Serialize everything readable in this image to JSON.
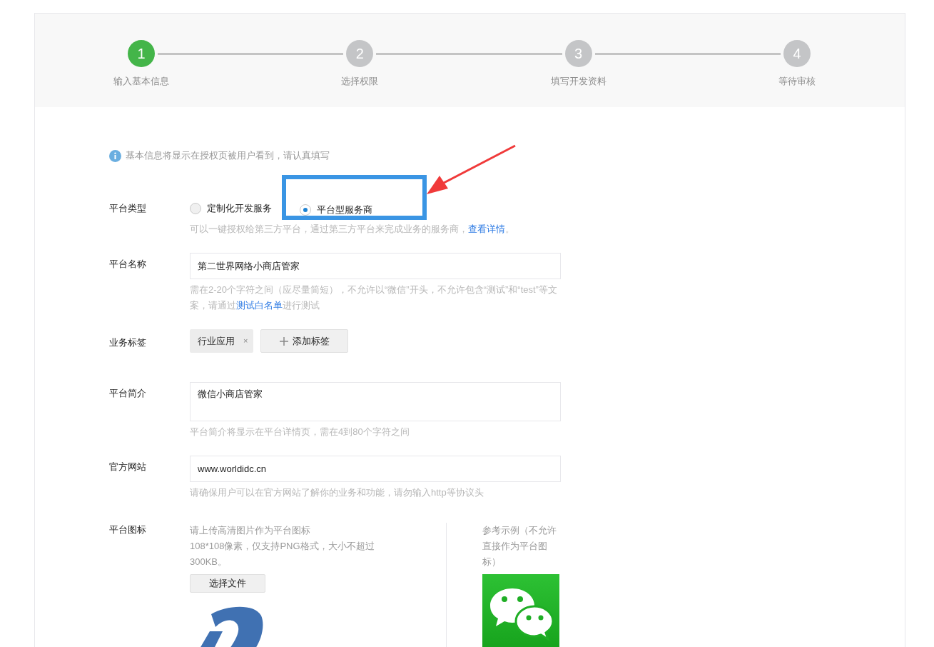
{
  "steps": [
    {
      "number": "1",
      "label": "输入基本信息",
      "selected": true
    },
    {
      "number": "2",
      "label": "选择权限",
      "selected": false
    },
    {
      "number": "3",
      "label": "填写开发资料",
      "selected": false
    },
    {
      "number": "4",
      "label": "等待审核",
      "selected": false
    }
  ],
  "notice": "基本信息将显示在授权页被用户看到，请认真填写",
  "platform_type": {
    "label": "平台类型",
    "options": [
      {
        "label": "定制化开发服务",
        "selected": false
      },
      {
        "label": "平台型服务商",
        "selected": true
      }
    ],
    "hint": "可以一键授权给第三方平台，通过第三方平台来完成业务的服务商，",
    "hint_link": "查看详情",
    "hint_tail": "。"
  },
  "platform_name": {
    "label": "平台名称",
    "value": "第二世界网络小商店管家",
    "hint": "需在2-20个字符之间（应尽量简短），不允许以“微信”开头，不允许包含“测试”和“test”等文案，请通过",
    "hint_link": "测试白名单",
    "hint_tail": "进行测试"
  },
  "business_tags": {
    "label": "业务标签",
    "tags": [
      {
        "label": "行业应用",
        "remove": "×"
      }
    ],
    "add_button": "添加标签"
  },
  "intro": {
    "label": "平台简介",
    "value": "微信小商店管家",
    "hint": "平台简介将显示在平台详情页，需在4到80个字符之间"
  },
  "website": {
    "label": "官方网站",
    "value": "www.worldidc.cn",
    "hint": "请确保用户可以在官方网站了解你的业务和功能，请勿输入http等协议头"
  },
  "platform_icon": {
    "label": "平台图标",
    "instruction": "请上传高清图片作为平台图标",
    "requirements": "108*108像素，仅支持PNG格式，大小不超过300KB。",
    "upload_button": "选择文件",
    "example_caption": "参考示例（不允许直接作为平台图标）"
  }
}
